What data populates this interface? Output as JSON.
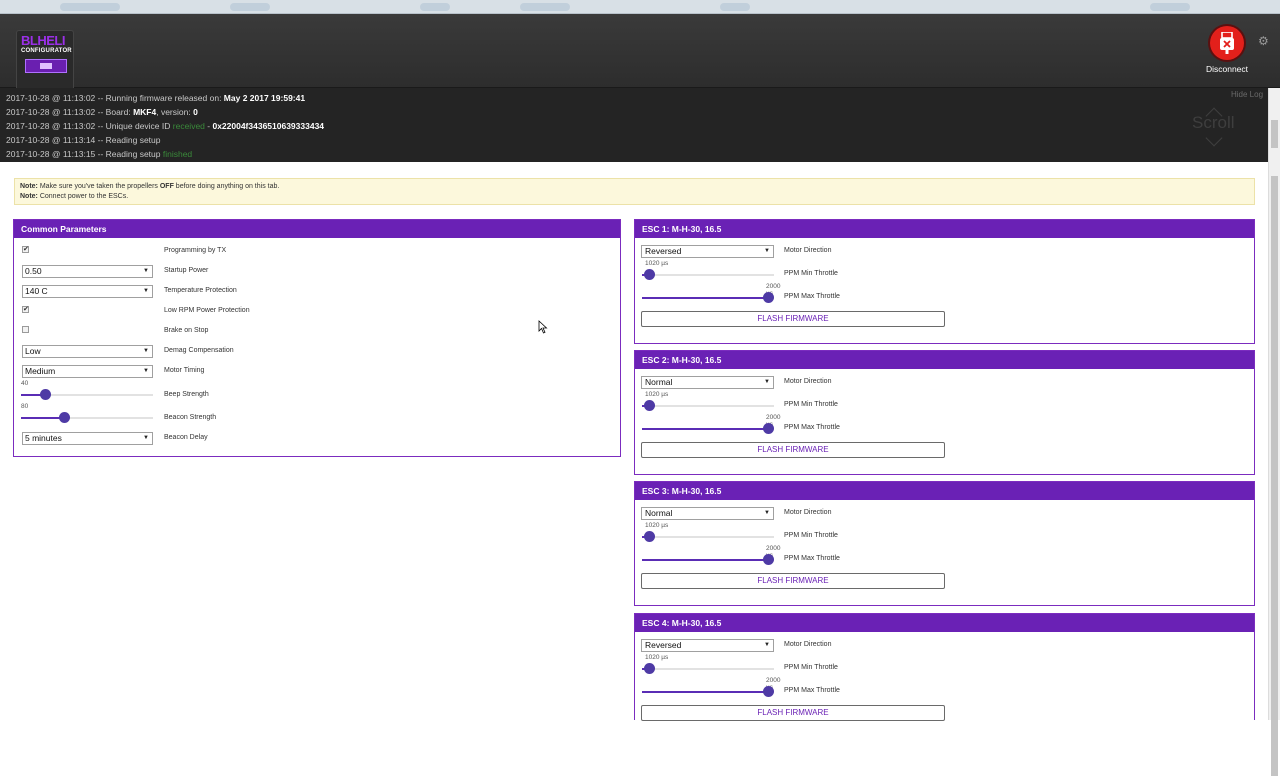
{
  "header": {
    "logo_text": "BLHELI",
    "logo_sub": "CONFIGURATOR",
    "disconnect_label": "Disconnect"
  },
  "log": {
    "hide_label": "Hide Log",
    "scroll_label": "Scroll",
    "entries": [
      {
        "prefix": "2017-10-28 @ 11:13:02 -- Running firmware released on: ",
        "bold": "May 2 2017 19:59:41",
        "green": "",
        "suffix": ""
      },
      {
        "prefix": "2017-10-28 @ 11:13:02 -- Board: ",
        "bold": "MKF4",
        "green": "",
        "suffix": ", version: ",
        "bold2": "0"
      },
      {
        "prefix": "2017-10-28 @ 11:13:02 -- Unique device ID ",
        "bold": "",
        "green": "received",
        "suffix": " - ",
        "bold2": "0x22004f3436510639333434"
      },
      {
        "prefix": "2017-10-28 @ 11:13:14 -- Reading setup",
        "bold": "",
        "green": "",
        "suffix": ""
      },
      {
        "prefix": "2017-10-28 @ 11:13:15 -- Reading setup ",
        "bold": "",
        "green": "finished",
        "suffix": ""
      }
    ]
  },
  "note": {
    "label1": "Note:",
    "text1a": " Make sure you've taken the propellers ",
    "off": "OFF",
    "text1b": " before doing anything on this tab.",
    "label2": "Note:",
    "text2": " Connect power to the ESCs."
  },
  "common": {
    "title": "Common Parameters",
    "programming_by_tx": {
      "checked": true,
      "label": "Programming by TX"
    },
    "startup_power": {
      "value": "0.50",
      "label": "Startup Power"
    },
    "temperature_protection": {
      "value": "140 C",
      "label": "Temperature Protection"
    },
    "low_rpm_power_protection": {
      "checked": true,
      "label": "Low RPM Power Protection"
    },
    "brake_on_stop": {
      "checked": false,
      "label": "Brake on Stop"
    },
    "demag_compensation": {
      "value": "Low",
      "label": "Demag Compensation"
    },
    "motor_timing": {
      "value": "Medium",
      "label": "Motor Timing"
    },
    "beep_strength": {
      "value": "40",
      "level": 0.157,
      "label": "Beep Strength"
    },
    "beacon_strength": {
      "value": "80",
      "level": 0.314,
      "label": "Beacon Strength"
    },
    "beacon_delay": {
      "value": "5 minutes",
      "label": "Beacon Delay"
    }
  },
  "escs": [
    {
      "title": "ESC 1: M-H-30, 16.5",
      "direction": "Reversed",
      "direction_label": "Motor Direction",
      "min_value": "1020 µs",
      "min_level": 0.02,
      "min_label": "PPM Min Throttle",
      "max_value": "2000 µs",
      "max_level": 1.0,
      "max_label": "PPM Max Throttle",
      "flash_label": "FLASH FIRMWARE"
    },
    {
      "title": "ESC 2: M-H-30, 16.5",
      "direction": "Normal",
      "direction_label": "Motor Direction",
      "min_value": "1020 µs",
      "min_level": 0.02,
      "min_label": "PPM Min Throttle",
      "max_value": "2000 µs",
      "max_level": 1.0,
      "max_label": "PPM Max Throttle",
      "flash_label": "FLASH FIRMWARE"
    },
    {
      "title": "ESC 3: M-H-30, 16.5",
      "direction": "Normal",
      "direction_label": "Motor Direction",
      "min_value": "1020 µs",
      "min_level": 0.02,
      "min_label": "PPM Min Throttle",
      "max_value": "2000 µs",
      "max_level": 1.0,
      "max_label": "PPM Max Throttle",
      "flash_label": "FLASH FIRMWARE"
    },
    {
      "title": "ESC 4: M-H-30, 16.5",
      "direction": "Reversed",
      "direction_label": "Motor Direction",
      "min_value": "1020 µs",
      "min_level": 0.02,
      "min_label": "PPM Min Throttle",
      "max_value": "2000 µs",
      "max_level": 1.0,
      "max_label": "PPM Max Throttle",
      "flash_label": "FLASH FIRMWARE"
    }
  ],
  "colors": {
    "accent": "#6a21b5",
    "knob": "#4e3aa5",
    "disconnect": "#e3201b",
    "log_bg": "#242424"
  }
}
